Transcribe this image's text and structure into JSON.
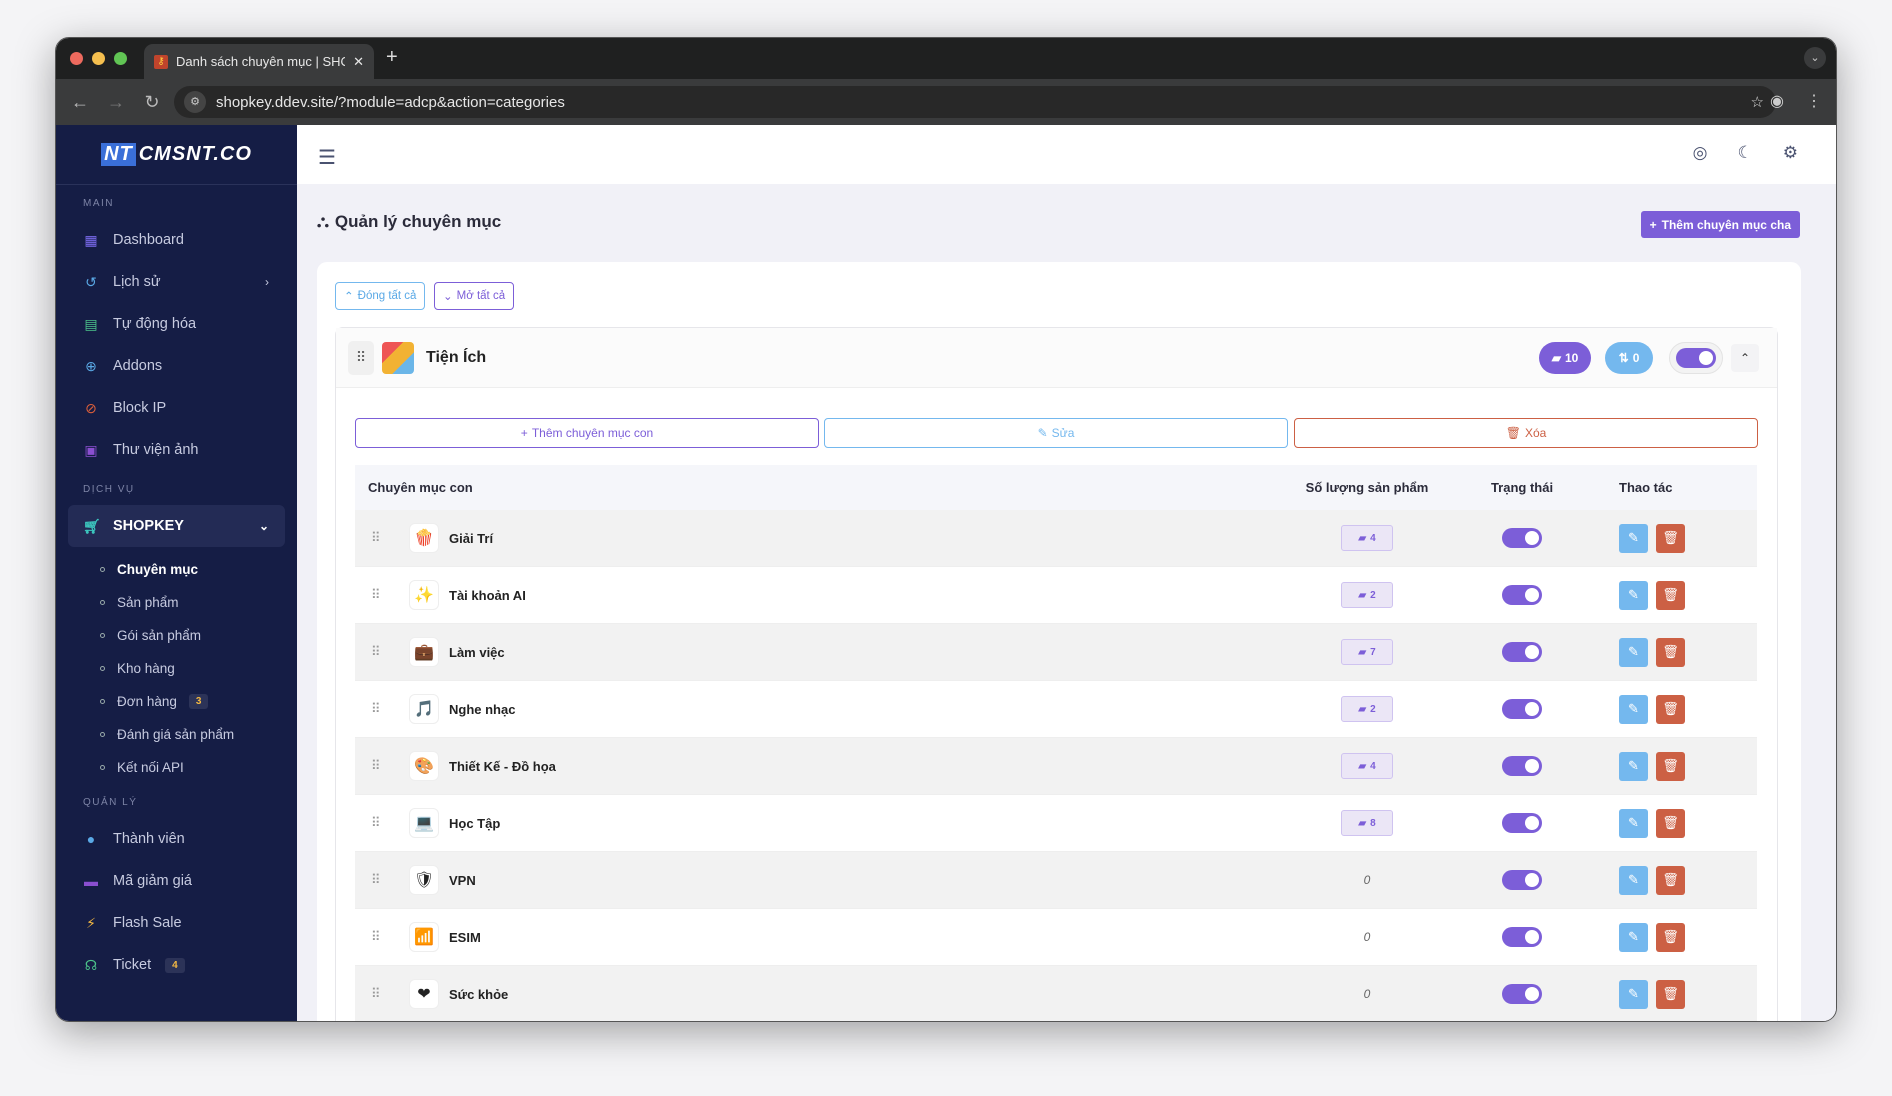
{
  "browser": {
    "tab_title": "Danh sách chuyên mục | SHO",
    "url": "shopkey.ddev.site/?module=adcp&action=categories"
  },
  "sidebar": {
    "logo": "CMSNT.CO",
    "sections": {
      "main": "MAIN",
      "services": "DỊCH VỤ",
      "manage": "QUẢN LÝ"
    },
    "main_items": [
      {
        "label": "Dashboard",
        "icon": "dashboard-icon"
      },
      {
        "label": "Lịch sử",
        "icon": "history-icon"
      },
      {
        "label": "Tự động hóa",
        "icon": "calendar-icon"
      },
      {
        "label": "Addons",
        "icon": "plus-circle-icon"
      },
      {
        "label": "Block IP",
        "icon": "ban-icon"
      },
      {
        "label": "Thư viện ảnh",
        "icon": "gallery-icon"
      }
    ],
    "shopkey": "SHOPKEY",
    "sub_items": [
      {
        "label": "Chuyên mục"
      },
      {
        "label": "Sản phẩm"
      },
      {
        "label": "Gói sản phẩm"
      },
      {
        "label": "Kho hàng"
      },
      {
        "label": "Đơn hàng",
        "badge": "3"
      },
      {
        "label": "Đánh giá sản phẩm"
      },
      {
        "label": "Kết nối API"
      }
    ],
    "manage_items": [
      {
        "label": "Thành viên"
      },
      {
        "label": "Mã giảm giá"
      },
      {
        "label": "Flash Sale"
      },
      {
        "label": "Ticket",
        "badge": "4"
      }
    ]
  },
  "page": {
    "title": "Quản lý chuyên mục",
    "add_parent": "Thêm chuyên mục cha",
    "collapse_all": "Đóng tất cả",
    "expand_all": "Mở tất cả"
  },
  "category": {
    "name": "Tiện Ích",
    "child_count": "10",
    "sort_count": "0",
    "enabled": true,
    "add_child": "Thêm chuyên mục con",
    "edit": "Sửa",
    "delete": "Xóa"
  },
  "table": {
    "headers": [
      "Chuyên mục con",
      "Số lượng sản phẩm",
      "Trạng thái",
      "Thao tác"
    ],
    "rows": [
      {
        "name": "Giải Trí",
        "qty": "4",
        "icon": "🍿"
      },
      {
        "name": "Tài khoản AI",
        "qty": "2",
        "icon": "✨"
      },
      {
        "name": "Làm việc",
        "qty": "7",
        "icon": "💼"
      },
      {
        "name": "Nghe nhạc",
        "qty": "2",
        "icon": "🎵"
      },
      {
        "name": "Thiết Kế - Đồ họa",
        "qty": "4",
        "icon": "🎨"
      },
      {
        "name": "Học Tập",
        "qty": "8",
        "icon": "💻"
      },
      {
        "name": "VPN",
        "qty": "0",
        "icon": "🛡"
      },
      {
        "name": "ESIM",
        "qty": "0",
        "icon": "📶"
      },
      {
        "name": "Sức khỏe",
        "qty": "0",
        "icon": "❤"
      }
    ]
  },
  "colors": {
    "accent": "#7c5ed8",
    "info": "#74b8ee",
    "danger": "#cc6044",
    "sidebar": "#151d45"
  }
}
